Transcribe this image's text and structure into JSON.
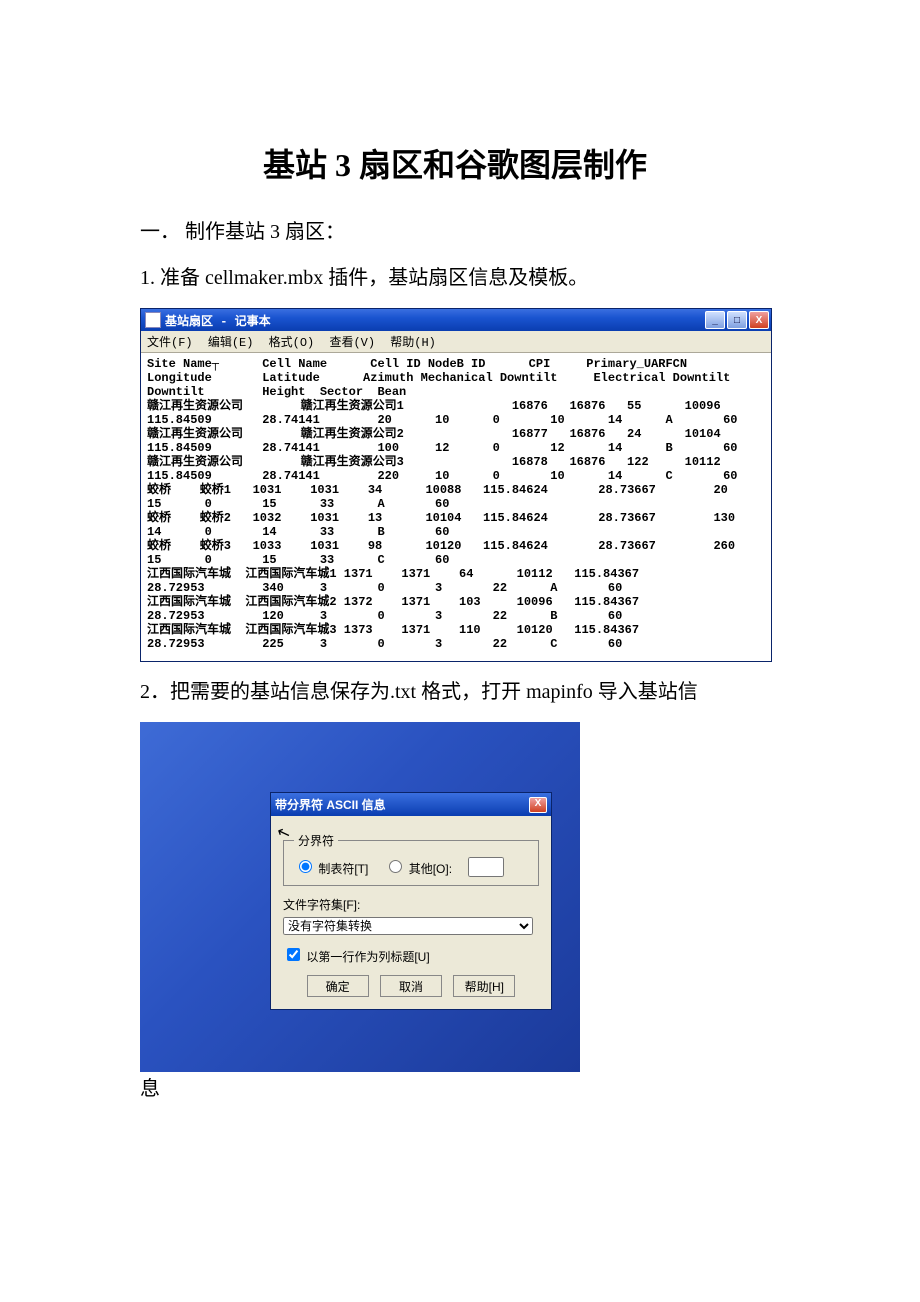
{
  "doc": {
    "title": "基站 3 扇区和谷歌图层制作",
    "section1": "一．  制作基站 3 扇区：",
    "step1": "1. 准备 cellmaker.mbx 插件，基站扇区信息及模板。",
    "step2_a": "2．把需要的基站信息保存为.txt 格式，打开 mapinfo 导入基站信",
    "step2_b": "息"
  },
  "notepad": {
    "title": "基站扇区 - 记事本",
    "menus": [
      "文件(F)",
      "编辑(E)",
      "格式(O)",
      "查看(V)",
      "帮助(H)"
    ],
    "content": "Site Name┬      Cell Name      Cell ID NodeB ID      CPI     Primary_UARFCN\nLongitude       Latitude      Azimuth Mechanical Downtilt     Electrical Downtilt\nDowntilt        Height  Sector  Bean\n赣江再生资源公司        赣江再生资源公司1               16876   16876   55      10096\n115.84509       28.74141        20      10      0       10      14      A       60\n赣江再生资源公司        赣江再生资源公司2               16877   16876   24      10104\n115.84509       28.74141        100     12      0       12      14      B       60\n赣江再生资源公司        赣江再生资源公司3               16878   16876   122     10112\n115.84509       28.74141        220     10      0       10      14      C       60\n蛟桥    蛟桥1   1031    1031    34      10088   115.84624       28.73667        20\n15      0       15      33      A       60\n蛟桥    蛟桥2   1032    1031    13      10104   115.84624       28.73667        130\n14      0       14      33      B       60\n蛟桥    蛟桥3   1033    1031    98      10120   115.84624       28.73667        260\n15      0       15      33      C       60\n江西国际汽车城  江西国际汽车城1 1371    1371    64      10112   115.84367\n28.72953        340     3       0       3       22      A       60\n江西国际汽车城  江西国际汽车城2 1372    1371    103     10096   115.84367\n28.72953        120     3       0       3       22      B       60\n江西国际汽车城  江西国际汽车城3 1373    1371    110     10120   115.84367\n28.72953        225     3       0       3       22      C       60"
  },
  "dialog": {
    "title": "带分界符 ASCII 信息",
    "group_label": "分界符",
    "radio_tab": "制表符[T]",
    "radio_other": "其他[O]:",
    "charset_label": "文件字符集[F]:",
    "charset_value": "没有字符集转换",
    "check_firstrow": "以第一行作为列标题[U]",
    "btn_ok": "确定",
    "btn_cancel": "取消",
    "btn_help": "帮助[H]"
  }
}
